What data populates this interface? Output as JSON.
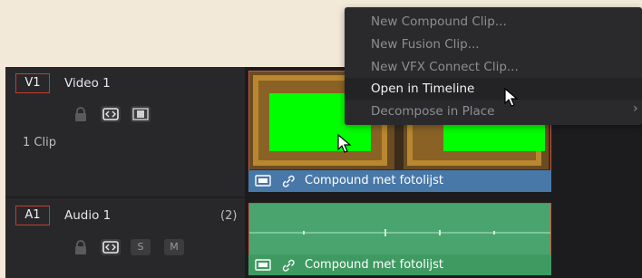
{
  "tracks": {
    "video": {
      "tag": "V1",
      "name": "Video 1",
      "clip_count": "1 Clip"
    },
    "audio": {
      "tag": "A1",
      "name": "Audio 1",
      "count": "(2)",
      "solo": "S",
      "mute": "M"
    }
  },
  "clips": {
    "video_label": "Compound met fotolijst",
    "audio_label": "Compound met fotolijst"
  },
  "context_menu": {
    "items": [
      {
        "label": "New Compound Clip...",
        "enabled": false
      },
      {
        "label": "New Fusion Clip...",
        "enabled": false
      },
      {
        "label": "New VFX Connect Clip...",
        "enabled": false
      },
      {
        "label": "Open in Timeline",
        "enabled": true
      },
      {
        "label": "Decompose in Place",
        "enabled": false,
        "submenu": true
      }
    ],
    "submenu_glyph": "›"
  },
  "icons": {
    "lock": "lock-icon",
    "auto_select": "auto-select-icon",
    "monitor": "film-strip-icon",
    "link": "link-icon",
    "clip_thumb": "clip-icon",
    "cursor": "mouse-pointer-icon"
  },
  "colors": {
    "record_tag": "#c83a2d",
    "video_clip_bar": "#4878a8",
    "audio_clip": "#4aa46e",
    "green_screen": "#00ff00"
  }
}
